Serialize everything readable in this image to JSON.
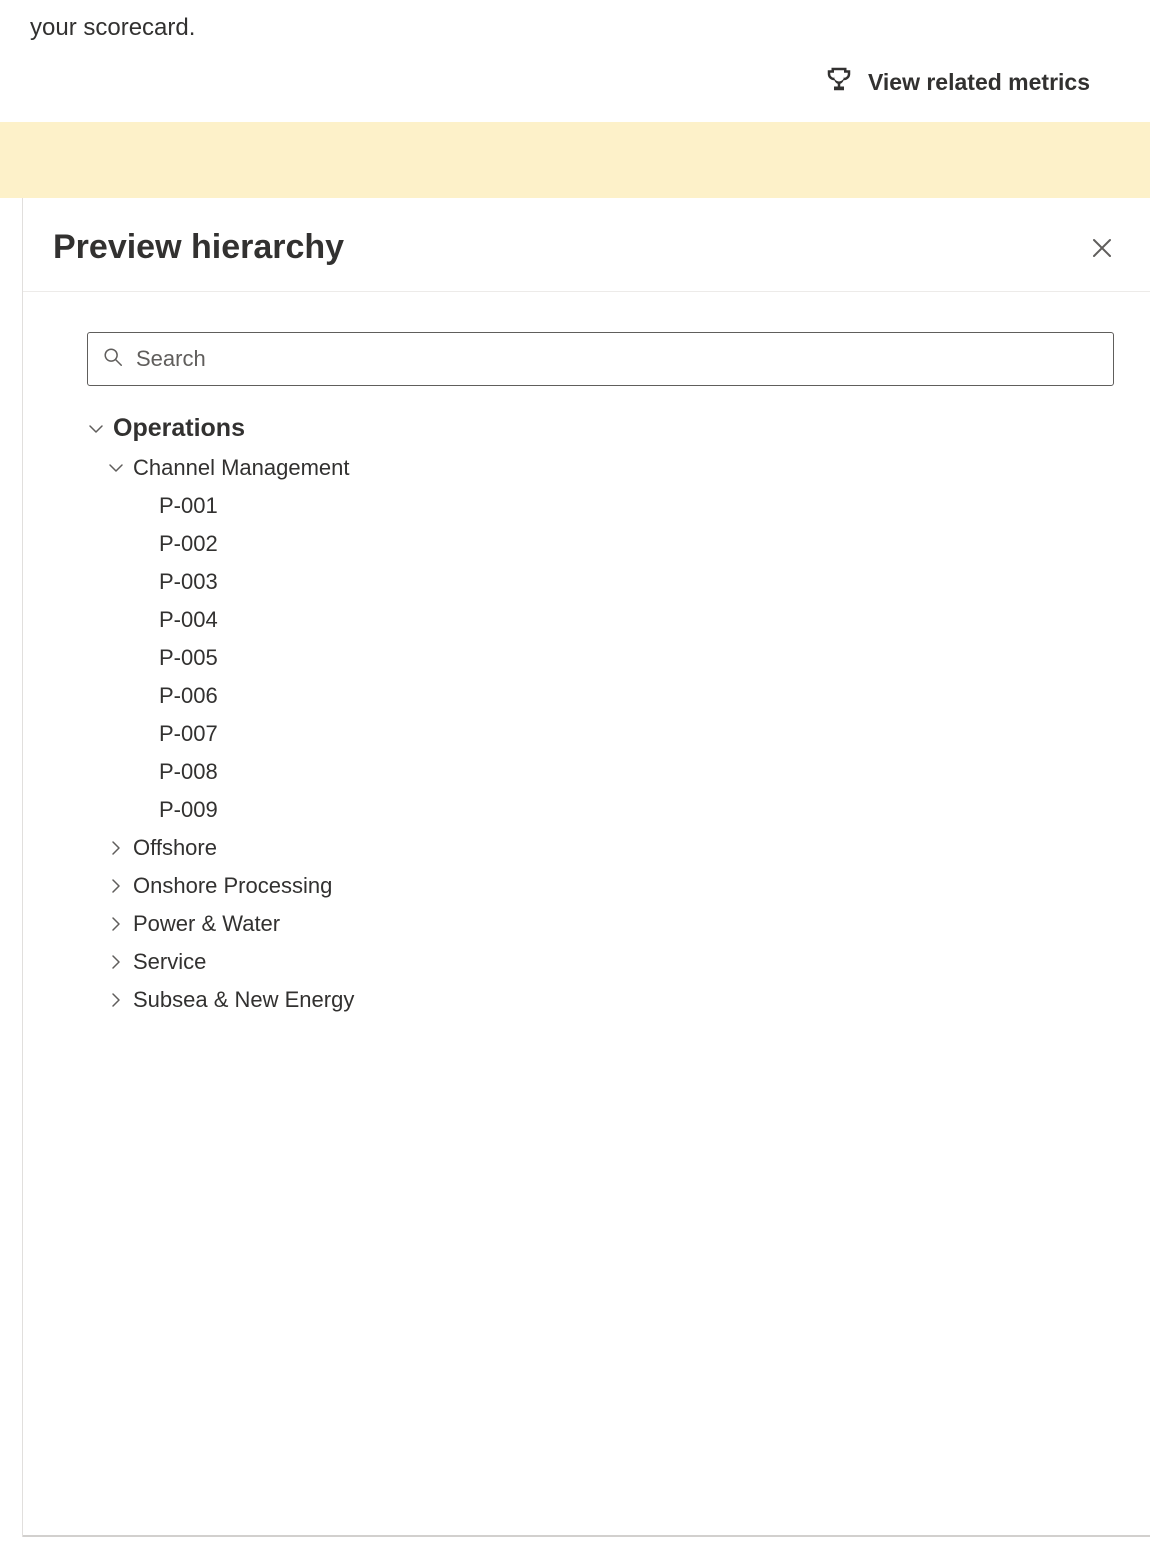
{
  "topbar": {
    "fragment_text": "your scorecard.",
    "view_related_label": "View related metrics"
  },
  "panel": {
    "title": "Preview hierarchy",
    "search_placeholder": "Search"
  },
  "tree": {
    "root": "Operations",
    "children": [
      {
        "label": "Channel Management",
        "expanded": true,
        "children": [
          "P-001",
          "P-002",
          "P-003",
          "P-004",
          "P-005",
          "P-006",
          "P-007",
          "P-008",
          "P-009"
        ]
      },
      {
        "label": "Offshore",
        "expanded": false
      },
      {
        "label": "Onshore Processing",
        "expanded": false
      },
      {
        "label": "Power & Water",
        "expanded": false
      },
      {
        "label": "Service",
        "expanded": false
      },
      {
        "label": "Subsea & New Energy",
        "expanded": false
      }
    ]
  }
}
